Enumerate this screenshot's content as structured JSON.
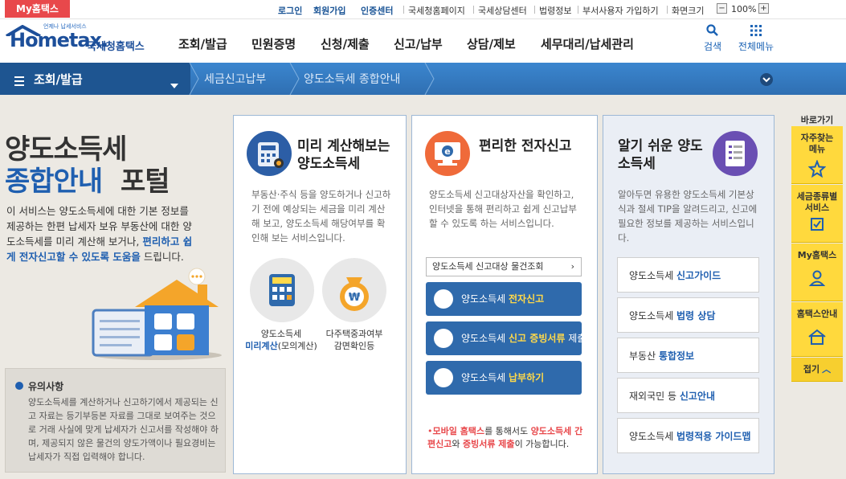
{
  "topbar": {
    "my_hometax": "My홈택스",
    "links": [
      "로그인",
      "회원가입",
      "인증센터",
      "국세청홈페이지",
      "국세상담센터",
      "법령정보",
      "부서사용자 가입하기",
      "화면크기"
    ],
    "zoom_minus": "−",
    "zoom_level": "100%",
    "zoom_plus": "+"
  },
  "header": {
    "logo_small": "언제나 납세서비스",
    "logo_text": "Hometax.",
    "logo_kr": "국세청홈택스",
    "menu": [
      "조회/발급",
      "민원증명",
      "신청/제출",
      "신고/납부",
      "상담/제보",
      "세무대리/납세관리"
    ],
    "search_label": "검색",
    "allmenu_label": "전체메뉴"
  },
  "nav": {
    "current": "조회/발급",
    "crumb1": "세금신고납부",
    "crumb2": "양도소득세 종합안내"
  },
  "intro": {
    "title_line1": "양도소득세",
    "title_line2a": "종합안내",
    "title_line2b": "포털",
    "desc_a": "이 서비스는 양도소득세에 대한 기본 정보를 제공하는 한편 납세자 보유 부동산에 대한 양도소득세를 미리 계산해 보거나, ",
    "desc_hl": "편리하고 쉽게 전자신고할 수 있도록 도움을",
    "desc_b": " 드립니다.",
    "notice_title": "유의사항",
    "notice_text": "양도소득세를 계산하거나 신고하기에서 제공되는 신고 자료는 등기부등본 자료를 그대로 보여주는 것으로 거래 사실에 맞게 납세자가 신고서를 작성해야 하며, 제공되지 않은 물건의 양도가액이나 필요경비는 납세자가 직접 입력해야 합니다."
  },
  "panel1": {
    "title": "미리 계산해보는 양도소득세",
    "desc": "부동산·주식 등을 양도하거나 신고하기 전에 예상되는 세금을 미리 계산해 보고, 양도소득세 해당여부를 확인해 보는 서비스입니다.",
    "item1_line1": "양도소득세",
    "item1_hl": "미리계산",
    "item1_rest": "(모의계산)",
    "item2_line1": "다주택중과여부",
    "item2_line2": "감면확인등"
  },
  "panel2": {
    "title": "편리한 전자신고",
    "desc": "양도소득세 신고대상자산을 확인하고, 인터넷을 통해 편리하고 쉽게 신고납부할 수 있도록 하는 서비스입니다.",
    "lookup": "양도소득세 신고대상 물건조회",
    "btn1_a": "양도소득세 ",
    "btn1_b": "전자신고",
    "btn2_a": "양도소득세 ",
    "btn2_b": "신고 증빙서류",
    "btn2_c": " 제출",
    "btn3_a": "양도소득세 ",
    "btn3_b": "납부하기",
    "mobile_a": "모바일 홈택스",
    "mobile_b": "를 통해서도 ",
    "mobile_c": "양도소득세 간편신고",
    "mobile_d": "와 ",
    "mobile_e": "증빙서류 제출",
    "mobile_f": "이 가능합니다."
  },
  "panel3": {
    "title": "알기 쉬운 양도소득세",
    "desc": "알아두면 유용한 양도소득세 기본상식과 절세 TIP을 알려드리고, 신고에 필요한 정보를 제공하는 서비스입니다.",
    "items": [
      {
        "a": "양도소득세 ",
        "b": "신고가이드"
      },
      {
        "a": "양도소득세 ",
        "b": "법령 상담"
      },
      {
        "a": "부동산 ",
        "b": "통합정보"
      },
      {
        "a": "재외국민 등 ",
        "b": "신고안내"
      },
      {
        "a": "양도소득세 ",
        "b": "법령적용 가이드맵"
      }
    ]
  },
  "quick": {
    "title": "바로가기",
    "items": [
      "자주찾는 메뉴",
      "세금종류별 서비스",
      "My홈택스",
      "홈택스안내"
    ],
    "fold": "접기"
  },
  "colors": {
    "blue": "#1f5fb0",
    "nav": "#3580c8",
    "yellow": "#ffd93d",
    "red": "#e8484b"
  }
}
